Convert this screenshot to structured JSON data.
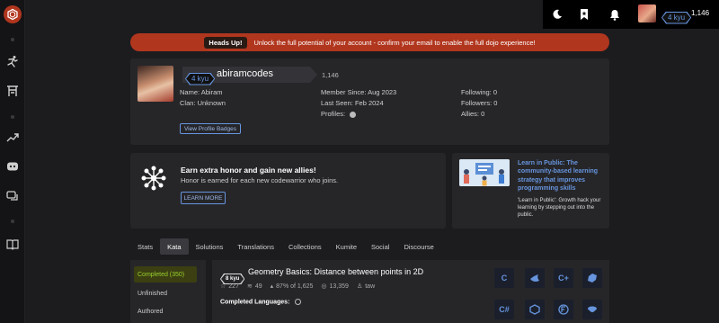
{
  "topbar": {
    "rank": "4 kyu",
    "honor": "1,146"
  },
  "banner": {
    "tag": "Heads Up!",
    "message": "Unlock the full potential of your account - confirm your email to enable the full dojo experience!"
  },
  "profile": {
    "rank": "4 kyu",
    "username": "abiramcodes",
    "honor": "1,146",
    "name": "Name: Abiram",
    "clan": "Clan: Unknown",
    "member_since": "Member Since: Aug 2023",
    "last_seen": "Last Seen: Feb 2024",
    "profiles": "Profiles:",
    "following": "Following: 0",
    "followers": "Followers: 0",
    "allies": "Allies: 0",
    "badges_button": "View Profile Badges"
  },
  "promo": {
    "title": "Earn extra honor and gain new allies!",
    "subtitle": "Honor is earned for each new codewarrior who joins.",
    "button": "LEARN MORE"
  },
  "learn_in_public": {
    "title": "Learn in Public: The community-based learning strategy that improves programming skills",
    "body": "'Learn in Public': Growth hack your learning by stepping out into the public."
  },
  "tabs": [
    "Stats",
    "Kata",
    "Solutions",
    "Translations",
    "Collections",
    "Kumite",
    "Social",
    "Discourse"
  ],
  "active_tab": "Kata",
  "subnav": [
    "Completed (350)",
    "Unfinished",
    "Authored"
  ],
  "kata": {
    "rank": "8 kyu",
    "title": "Geometry Basics: Distance between points in 2D",
    "stars": "227",
    "collections": "49",
    "satisfaction": "87% of 1,625",
    "completed": "13,359",
    "author": "taw",
    "completed_languages_label": "Completed Languages:"
  },
  "languages": [
    "C",
    "Swift",
    "C++",
    "Crystal",
    "C#",
    "Node.js",
    "Fortran",
    "CoffeeScript"
  ],
  "colors": {
    "accent": "#b1361e",
    "rank_blue": "#6795de",
    "completed_green": "#9ad02d"
  }
}
